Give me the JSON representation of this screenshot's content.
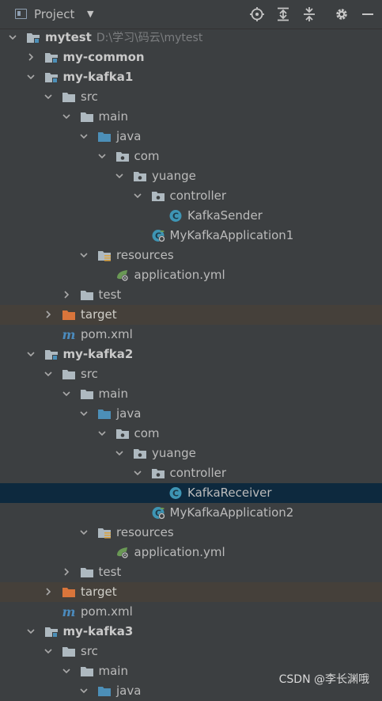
{
  "header": {
    "title": "Project",
    "icons": [
      "locate-icon",
      "expand-all-icon",
      "collapse-all-icon",
      "gear-icon",
      "hide-icon"
    ]
  },
  "tree": [
    {
      "label": "mytest",
      "path": "D:\\学习\\码云\\mytest",
      "depth": 0,
      "expanded": true,
      "icon": "module-folder",
      "bold": true
    },
    {
      "label": "my-common",
      "depth": 1,
      "expanded": false,
      "icon": "module-folder",
      "bold": true
    },
    {
      "label": "my-kafka1",
      "depth": 1,
      "expanded": true,
      "icon": "module-folder",
      "bold": true
    },
    {
      "label": "src",
      "depth": 2,
      "expanded": true,
      "icon": "folder"
    },
    {
      "label": "main",
      "depth": 3,
      "expanded": true,
      "icon": "folder"
    },
    {
      "label": "java",
      "depth": 4,
      "expanded": true,
      "icon": "source-folder"
    },
    {
      "label": "com",
      "depth": 5,
      "expanded": true,
      "icon": "package"
    },
    {
      "label": "yuange",
      "depth": 6,
      "expanded": true,
      "icon": "package"
    },
    {
      "label": "controller",
      "depth": 7,
      "expanded": true,
      "icon": "package"
    },
    {
      "label": "KafkaSender",
      "depth": 8,
      "icon": "class"
    },
    {
      "label": "MyKafkaApplication1",
      "depth": 7,
      "icon": "spring-class"
    },
    {
      "label": "resources",
      "depth": 4,
      "expanded": true,
      "icon": "resources-folder"
    },
    {
      "label": "application.yml",
      "depth": 5,
      "icon": "yml"
    },
    {
      "label": "test",
      "depth": 3,
      "expanded": false,
      "icon": "folder"
    },
    {
      "label": "target",
      "depth": 2,
      "expanded": false,
      "icon": "excluded-folder",
      "excluded": true
    },
    {
      "label": "pom.xml",
      "depth": 2,
      "icon": "maven"
    },
    {
      "label": "my-kafka2",
      "depth": 1,
      "expanded": true,
      "icon": "module-folder",
      "bold": true
    },
    {
      "label": "src",
      "depth": 2,
      "expanded": true,
      "icon": "folder"
    },
    {
      "label": "main",
      "depth": 3,
      "expanded": true,
      "icon": "folder"
    },
    {
      "label": "java",
      "depth": 4,
      "expanded": true,
      "icon": "source-folder"
    },
    {
      "label": "com",
      "depth": 5,
      "expanded": true,
      "icon": "package"
    },
    {
      "label": "yuange",
      "depth": 6,
      "expanded": true,
      "icon": "package"
    },
    {
      "label": "controller",
      "depth": 7,
      "expanded": true,
      "icon": "package"
    },
    {
      "label": "KafkaReceiver",
      "depth": 8,
      "icon": "class",
      "selected": true
    },
    {
      "label": "MyKafkaApplication2",
      "depth": 7,
      "icon": "spring-class"
    },
    {
      "label": "resources",
      "depth": 4,
      "expanded": true,
      "icon": "resources-folder"
    },
    {
      "label": "application.yml",
      "depth": 5,
      "icon": "yml"
    },
    {
      "label": "test",
      "depth": 3,
      "expanded": false,
      "icon": "folder"
    },
    {
      "label": "target",
      "depth": 2,
      "expanded": false,
      "icon": "excluded-folder",
      "excluded": true
    },
    {
      "label": "pom.xml",
      "depth": 2,
      "icon": "maven"
    },
    {
      "label": "my-kafka3",
      "depth": 1,
      "expanded": true,
      "icon": "module-folder",
      "bold": true
    },
    {
      "label": "src",
      "depth": 2,
      "expanded": true,
      "icon": "folder"
    },
    {
      "label": "main",
      "depth": 3,
      "expanded": true,
      "icon": "folder"
    },
    {
      "label": "java",
      "depth": 4,
      "expanded": true,
      "icon": "source-folder"
    }
  ],
  "watermark": "CSDN @李长渊哦",
  "colors": {
    "background": "#3c3f41",
    "selected_row": "#0d293e",
    "excluded_row": "#45403a",
    "folder": "#aeb9c0",
    "source_folder": "#4c8fb8",
    "excluded_folder": "#d9753b",
    "class_icon": "#3e95b4",
    "spring_leaf": "#6a9955",
    "maven": "#4b8bbe"
  }
}
